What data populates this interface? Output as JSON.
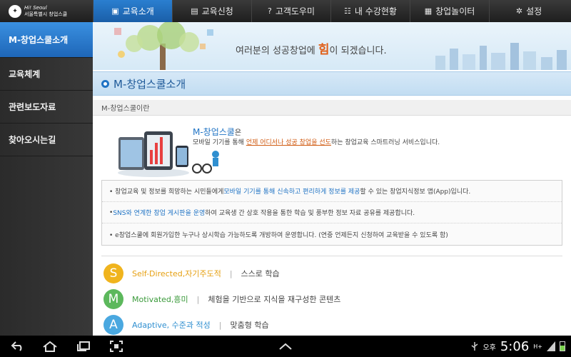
{
  "logo": {
    "line1": "Hi! Seoul",
    "line2": "서울특별시 창업스쿨"
  },
  "tabs": [
    {
      "label": "교육소개",
      "icon": "monitor-icon",
      "glyph": "▣"
    },
    {
      "label": "교육신청",
      "icon": "document-icon",
      "glyph": "▤"
    },
    {
      "label": "고객도우미",
      "icon": "help-icon",
      "glyph": "?"
    },
    {
      "label": "내 수강현황",
      "icon": "profile-card-icon",
      "glyph": "☷"
    },
    {
      "label": "창업놀이터",
      "icon": "printer-icon",
      "glyph": "▦"
    },
    {
      "label": "설정",
      "icon": "gear-icon",
      "glyph": "✲"
    }
  ],
  "sidebar": {
    "items": [
      {
        "label": "M-창업스쿨소개"
      },
      {
        "label": "교육체계"
      },
      {
        "label": "관련보도자료"
      },
      {
        "label": "찾아오시는길"
      }
    ]
  },
  "banner": {
    "text_before": "여러분의 성공창업에 ",
    "text_big": "힘",
    "text_after": "이 되겠습니다."
  },
  "section": {
    "title": "M-창업스쿨소개"
  },
  "subhead": "M-창업스쿨이란",
  "intro": {
    "title": "M-창업스쿨",
    "title_suffix": "은",
    "desc_before": "모바일 기기를 통해 ",
    "desc_highlight": "언제 어디서나 성공 창업을 선도",
    "desc_after": "하는 창업교육 스마트러닝 서비스입니다."
  },
  "info": {
    "row1": {
      "a": "• 창업교육 및 정보를 희망하는 시민들에게 ",
      "b": "모바일 기기를 통해 신속하고 편리하게 정보를 제공",
      "c": "할 수 있는 창업지식정보 앱(App)입니다."
    },
    "row2": {
      "a": "• ",
      "b": "SNS와 연계한 창업 게시판을 운영",
      "c": "하여 교육생 간 상호 작용을 통한 학습 및 풍부한 정보 자료 공유를 제공합니다."
    },
    "row3": {
      "a": "• e창업스쿨에 회원가입한 누구나 상시학습 가능하도록 개방하여 운영합니다. (연중 언제든지 신청하여 교육받을 수 있도록 함)"
    }
  },
  "ssma": [
    {
      "letter": "S",
      "label": "Self-Directed,자기주도적",
      "sep": "|",
      "desc": "스스로 학습",
      "color": "#f0b41e",
      "label_color": "#e6a012"
    },
    {
      "letter": "M",
      "label": "Motivated,흥미",
      "sep": "|",
      "desc": "체험을 기반으로 지식을 재구성한 콘텐츠",
      "color": "#5cb85c",
      "label_color": "#3a9a3a"
    },
    {
      "letter": "A",
      "label": "Adaptive, 수준과 적성",
      "sep": "|",
      "desc": "맞춤형 학습",
      "color": "#4aa8e0",
      "label_color": "#2f8fd0"
    }
  ],
  "statusbar": {
    "ampm": "오후",
    "time": "5:06",
    "network": "H+",
    "battery_level": 0.6
  }
}
